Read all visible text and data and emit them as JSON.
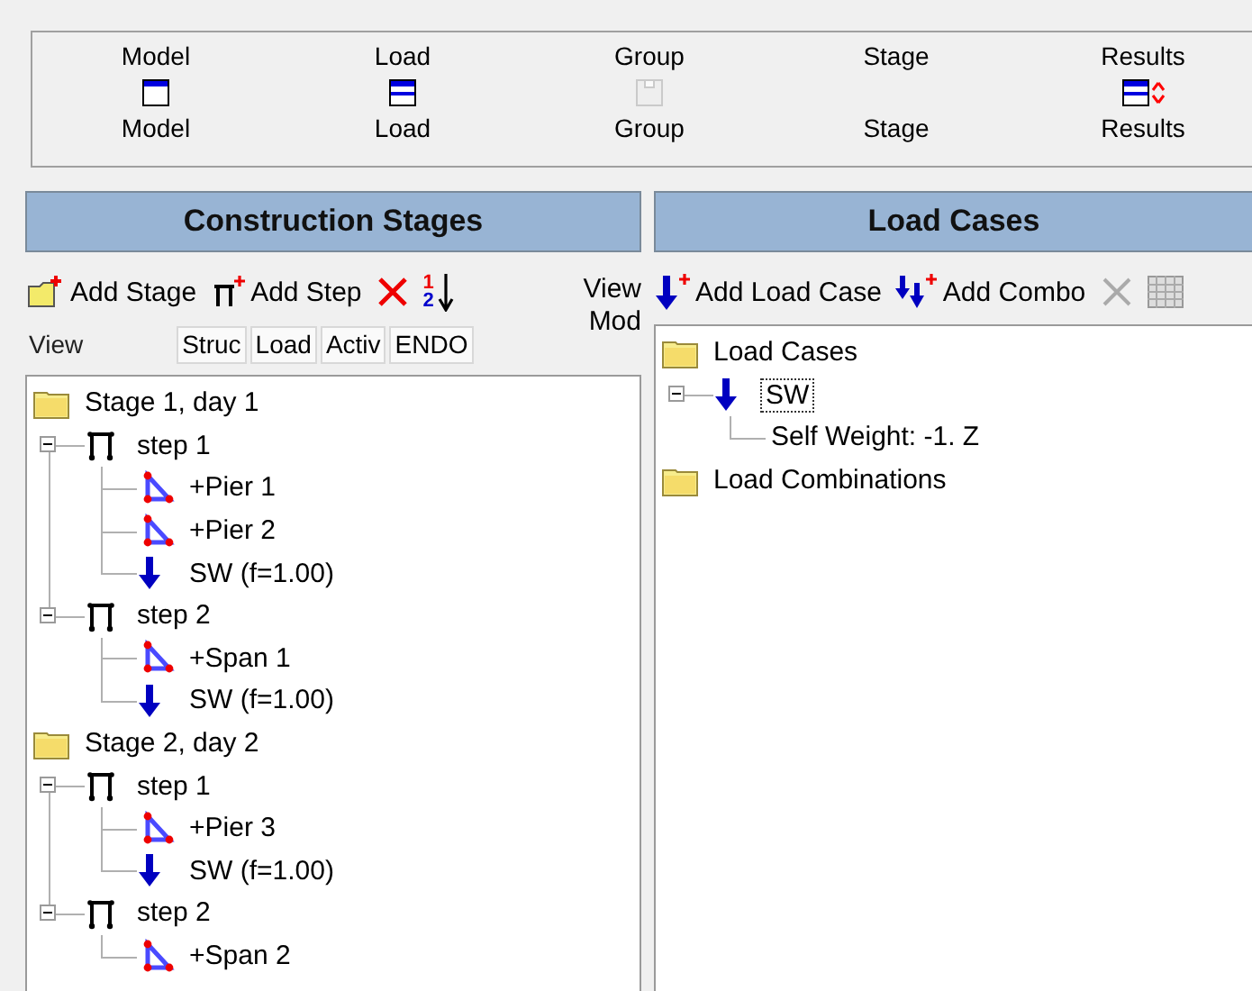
{
  "top_toolbar": [
    {
      "kind": "model",
      "label_top": "Model",
      "label_bottom": "Model",
      "disabled": false
    },
    {
      "kind": "load",
      "label_top": "Load",
      "label_bottom": "Load",
      "disabled": false
    },
    {
      "kind": "group",
      "label_top": "Group",
      "label_bottom": "Group",
      "disabled": true
    },
    {
      "kind": "stage",
      "label_top": "Stage",
      "label_bottom": "Stage"
    },
    {
      "kind": "results",
      "label_top": "Results",
      "label_bottom": "Results",
      "disabled": false
    }
  ],
  "construction_stages": {
    "title": "Construction Stages",
    "toolbar": [
      {
        "kind": "add_stage",
        "label": "Add Stage"
      },
      {
        "kind": "add_step",
        "label": "Add Step"
      },
      {
        "kind": "delete"
      },
      {
        "kind": "sort",
        "digits": [
          "1",
          "2"
        ]
      }
    ],
    "view_mode_label": "View Mod",
    "view_label": "View",
    "view_tabs": [
      "Struc",
      "Load",
      "Activ",
      "ENDO"
    ],
    "tree": [
      {
        "kind": "folder",
        "label": "Stage 1, day 1",
        "selected": false,
        "children": [
          {
            "kind": "step",
            "label": "step 1",
            "expanded": true,
            "selected": false,
            "children": [
              {
                "kind": "part",
                "label": "+Pier 1",
                "selected": false
              },
              {
                "kind": "part",
                "label": "+Pier 2",
                "selected": false
              },
              {
                "kind": "load",
                "label": "SW (f=1.00)",
                "selected": false
              }
            ]
          },
          {
            "kind": "step",
            "label": "step 2",
            "expanded": true,
            "selected": false,
            "children": [
              {
                "kind": "part",
                "label": "+Span 1",
                "selected": false
              },
              {
                "kind": "load",
                "label": "SW (f=1.00)",
                "selected": false
              }
            ]
          }
        ]
      },
      {
        "kind": "folder",
        "label": "Stage 2, day 2",
        "selected": false,
        "children": [
          {
            "kind": "step",
            "label": "step 1",
            "expanded": true,
            "selected": false,
            "children": [
              {
                "kind": "part",
                "label": "+Pier 3",
                "selected": false
              },
              {
                "kind": "load",
                "label": "SW (f=1.00)",
                "selected": false
              }
            ]
          },
          {
            "kind": "step",
            "label": "step 2",
            "expanded": true,
            "selected": false,
            "children": [
              {
                "kind": "part",
                "label": "+Span 2",
                "selected": false
              }
            ]
          }
        ]
      }
    ]
  },
  "load_cases": {
    "title": "Load Cases",
    "toolbar": [
      {
        "kind": "add_load_case",
        "label": "Add Load Case",
        "disabled": false
      },
      {
        "kind": "add_combo",
        "label": "Add Combo",
        "disabled": false
      },
      {
        "kind": "delete",
        "disabled": true
      },
      {
        "kind": "table",
        "disabled": true
      }
    ],
    "tree": [
      {
        "kind": "folder",
        "label": "Load Cases",
        "selected": false,
        "children": [
          {
            "kind": "load",
            "label": "SW",
            "expanded": true,
            "selected": true,
            "children": [
              {
                "kind": "text",
                "label": "Self Weight: -1. Z",
                "selected": false
              }
            ]
          }
        ]
      },
      {
        "kind": "folder",
        "label": "Load Combinations",
        "selected": false
      }
    ]
  }
}
